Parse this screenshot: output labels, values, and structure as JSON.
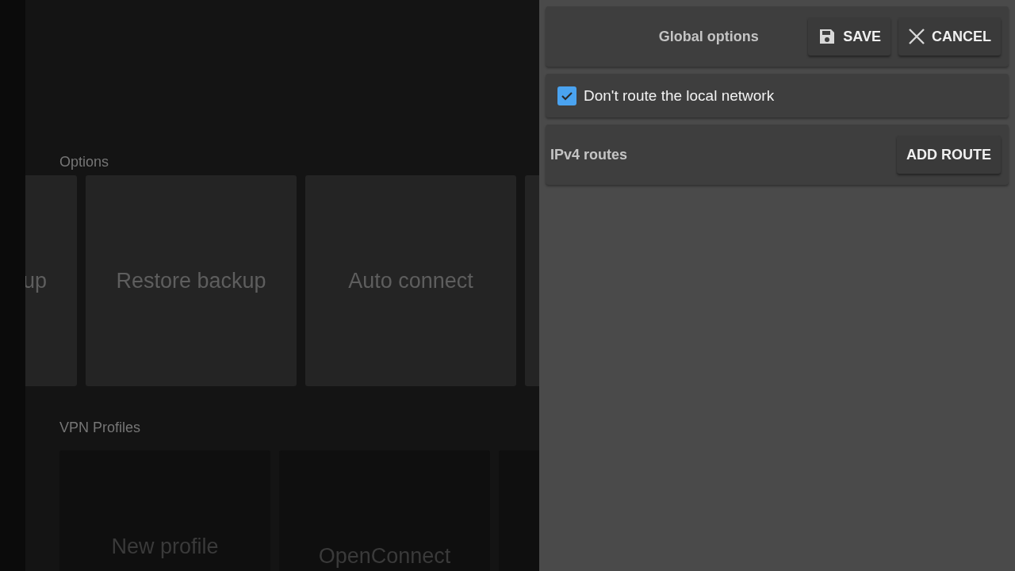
{
  "sections": [
    {
      "title": "Options",
      "cards": [
        {
          "kind": "tile",
          "label": "up"
        },
        {
          "kind": "tile",
          "label": "Restore backup"
        },
        {
          "kind": "tile",
          "label": "Auto connect"
        },
        {
          "kind": "tile"
        }
      ]
    },
    {
      "title": "VPN Profiles",
      "cards": [
        {
          "kind": "profile",
          "label": "New profile"
        },
        {
          "kind": "profile",
          "label": "OpenConnect"
        },
        {
          "kind": "profile"
        }
      ]
    }
  ],
  "dialog": {
    "title": "Global options",
    "buttons": [
      {
        "kind": "save",
        "label": "SAVE"
      },
      {
        "kind": "cancel",
        "label": "CANCEL"
      }
    ],
    "options": [
      {
        "label": "Don't route the local network",
        "checked": true
      }
    ],
    "routes": {
      "title": "IPv4 routes",
      "button": "ADD ROUTE"
    }
  }
}
